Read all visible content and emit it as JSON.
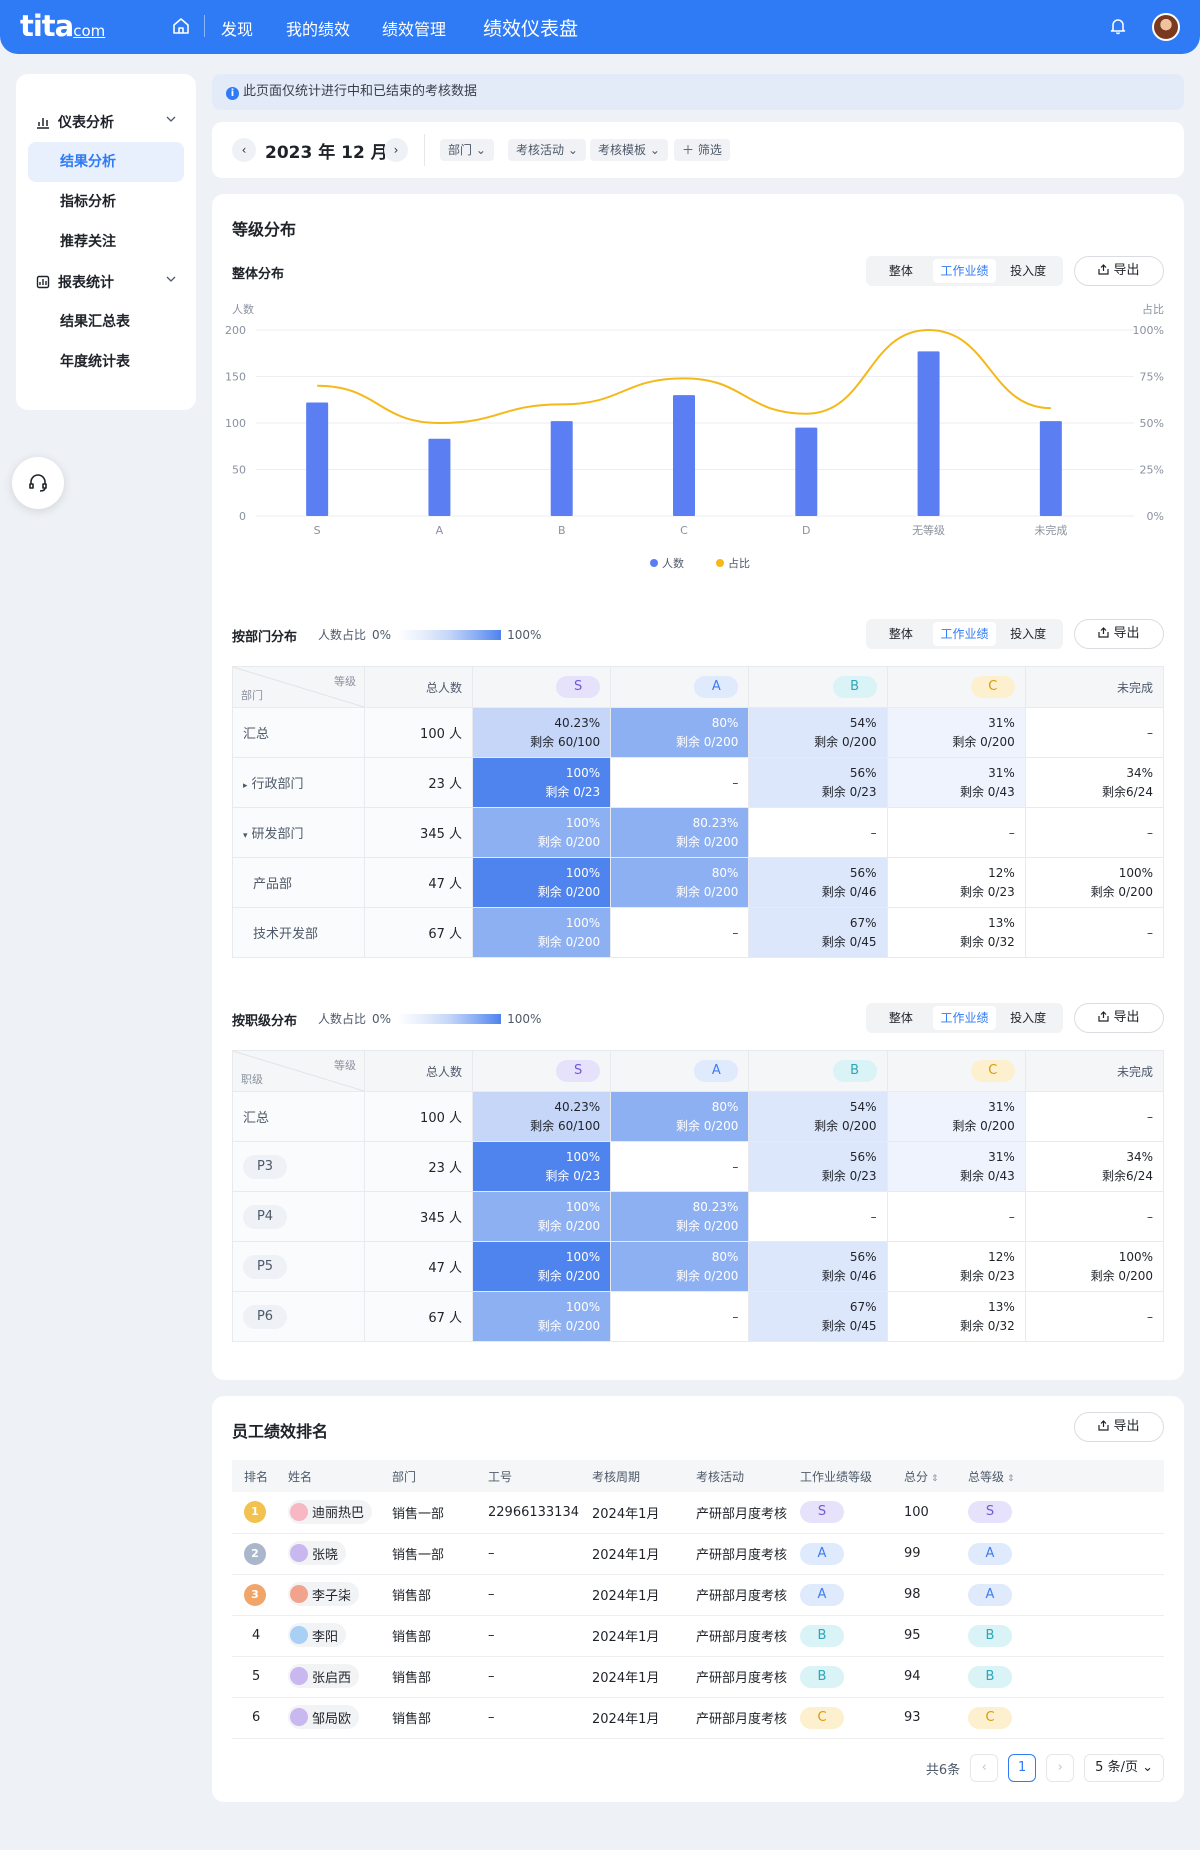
{
  "topbar": {
    "logo": "tita",
    "logo_suffix": "com",
    "nav": [
      "发现",
      "我的绩效",
      "绩效管理",
      "绩效仪表盘"
    ]
  },
  "sidebar": {
    "groups": [
      {
        "label": "仪表分析",
        "items": [
          "结果分析",
          "指标分析",
          "推荐关注"
        ]
      },
      {
        "label": "报表统计",
        "items": [
          "结果汇总表",
          "年度统计表"
        ]
      }
    ]
  },
  "notice": "此页面仅统计进行中和已结束的考核数据",
  "filter": {
    "date": "2023 年 12 月",
    "chips": [
      "部门",
      "考核活动",
      "考核模板",
      "＋ 筛选"
    ]
  },
  "grade_card": {
    "title": "等级分布",
    "overall_title": "整体分布",
    "tabs": [
      "整体",
      "工作业绩",
      "投入度"
    ],
    "export": "导出"
  },
  "chart_data": {
    "type": "bar",
    "categories": [
      "S",
      "A",
      "B",
      "C",
      "D",
      "无等级",
      "未完成"
    ],
    "series": [
      {
        "name": "人数",
        "type": "bar",
        "values": [
          122,
          83,
          102,
          130,
          95,
          177,
          102
        ],
        "color": "#5b7ff3"
      },
      {
        "name": "占比",
        "type": "line",
        "values": [
          70,
          50,
          60,
          74,
          55,
          100,
          58
        ],
        "color": "#f5b819"
      }
    ],
    "ylabel": "人数",
    "ylabel_right": "占比",
    "ylim": [
      0,
      200
    ],
    "yticks": [
      "0",
      "50",
      "100",
      "150",
      "200"
    ],
    "y2lim": [
      0,
      100
    ],
    "y2ticks": [
      "0%",
      "25%",
      "50%",
      "75%",
      "100%"
    ],
    "legend_position": "bottom",
    "grid": true
  },
  "dept_table": {
    "title": "按部门分布",
    "legend_label": "人数占比",
    "legend_min": "0%",
    "legend_max": "100%",
    "corner_top": "等级",
    "corner_bottom": "部门",
    "headers": [
      "总人数",
      "S",
      "A",
      "B",
      "C",
      "未完成"
    ],
    "rows": [
      {
        "name": "汇总",
        "prefix": "",
        "total": "100 人",
        "cells": [
          {
            "pct": "40.23%",
            "rem": "剩余 60/100",
            "level": 0.25
          },
          {
            "pct": "80%",
            "rem": "剩余 0/200",
            "level": 0.6
          },
          {
            "pct": "54%",
            "rem": "剩余 0/200",
            "level": 0.2
          },
          {
            "pct": "31%",
            "rem": "剩余 0/200",
            "level": 0.05
          },
          {
            "pct": "",
            "rem": "",
            "level": 0
          }
        ]
      },
      {
        "name": "行政部门",
        "prefix": "▸",
        "total": "23 人",
        "cells": [
          {
            "pct": "100%",
            "rem": "剩余 0/23",
            "level": 1
          },
          {
            "pct": "",
            "rem": "",
            "level": 0
          },
          {
            "pct": "56%",
            "rem": "剩余 0/23",
            "level": 0.2
          },
          {
            "pct": "31%",
            "rem": "剩余 0/43",
            "level": 0.05
          },
          {
            "pct": "34%",
            "rem": "剩余6/24",
            "level": 0
          }
        ]
      },
      {
        "name": "研发部门",
        "prefix": "▾",
        "total": "345 人",
        "cells": [
          {
            "pct": "100%",
            "rem": "剩余 0/200",
            "level": 0.6
          },
          {
            "pct": "80.23%",
            "rem": "剩余 0/200",
            "level": 0.6
          },
          {
            "pct": "",
            "rem": "",
            "level": 0
          },
          {
            "pct": "",
            "rem": "",
            "level": 0
          },
          {
            "pct": "",
            "rem": "",
            "level": 0
          }
        ]
      },
      {
        "name": "产品部",
        "prefix": "",
        "total": "47 人",
        "cells": [
          {
            "pct": "100%",
            "rem": "剩余 0/200",
            "level": 1
          },
          {
            "pct": "80%",
            "rem": "剩余 0/200",
            "level": 0.6
          },
          {
            "pct": "56%",
            "rem": "剩余 0/46",
            "level": 0.2
          },
          {
            "pct": "12%",
            "rem": "剩余 0/23",
            "level": 0
          },
          {
            "pct": "100%",
            "rem": "剩余 0/200",
            "level": 0
          }
        ]
      },
      {
        "name": "技术开发部",
        "prefix": "",
        "total": "67 人",
        "cells": [
          {
            "pct": "100%",
            "rem": "剩余 0/200",
            "level": 0.6
          },
          {
            "pct": "",
            "rem": "",
            "level": 0
          },
          {
            "pct": "67%",
            "rem": "剩余 0/45",
            "level": 0.2
          },
          {
            "pct": "13%",
            "rem": "剩余 0/32",
            "level": 0
          },
          {
            "pct": "",
            "rem": "",
            "level": 0
          }
        ]
      }
    ]
  },
  "level_table": {
    "title": "按职级分布",
    "legend_label": "人数占比",
    "legend_min": "0%",
    "legend_max": "100%",
    "corner_top": "等级",
    "corner_bottom": "职级",
    "headers": [
      "总人数",
      "S",
      "A",
      "B",
      "C",
      "未完成"
    ],
    "rows": [
      {
        "name": "汇总",
        "tag": false,
        "total": "100 人",
        "cells": [
          {
            "pct": "40.23%",
            "rem": "剩余 60/100",
            "level": 0.25
          },
          {
            "pct": "80%",
            "rem": "剩余 0/200",
            "level": 0.6
          },
          {
            "pct": "54%",
            "rem": "剩余 0/200",
            "level": 0.2
          },
          {
            "pct": "31%",
            "rem": "剩余 0/200",
            "level": 0.05
          },
          {
            "pct": "",
            "rem": "",
            "level": 0
          }
        ]
      },
      {
        "name": "P3",
        "tag": true,
        "total": "23 人",
        "cells": [
          {
            "pct": "100%",
            "rem": "剩余 0/23",
            "level": 1
          },
          {
            "pct": "",
            "rem": "",
            "level": 0
          },
          {
            "pct": "56%",
            "rem": "剩余 0/23",
            "level": 0.2
          },
          {
            "pct": "31%",
            "rem": "剩余 0/43",
            "level": 0.05
          },
          {
            "pct": "34%",
            "rem": "剩余6/24",
            "level": 0
          }
        ]
      },
      {
        "name": "P4",
        "tag": true,
        "total": "345 人",
        "cells": [
          {
            "pct": "100%",
            "rem": "剩余 0/200",
            "level": 0.6
          },
          {
            "pct": "80.23%",
            "rem": "剩余 0/200",
            "level": 0.6
          },
          {
            "pct": "",
            "rem": "",
            "level": 0
          },
          {
            "pct": "",
            "rem": "",
            "level": 0
          },
          {
            "pct": "",
            "rem": "",
            "level": 0
          }
        ]
      },
      {
        "name": "P5",
        "tag": true,
        "total": "47 人",
        "cells": [
          {
            "pct": "100%",
            "rem": "剩余 0/200",
            "level": 1
          },
          {
            "pct": "80%",
            "rem": "剩余 0/200",
            "level": 0.6
          },
          {
            "pct": "56%",
            "rem": "剩余 0/46",
            "level": 0.2
          },
          {
            "pct": "12%",
            "rem": "剩余 0/23",
            "level": 0
          },
          {
            "pct": "100%",
            "rem": "剩余 0/200",
            "level": 0
          }
        ]
      },
      {
        "name": "P6",
        "tag": true,
        "total": "67 人",
        "cells": [
          {
            "pct": "100%",
            "rem": "剩余 0/200",
            "level": 0.6
          },
          {
            "pct": "",
            "rem": "",
            "level": 0
          },
          {
            "pct": "67%",
            "rem": "剩余 0/45",
            "level": 0.2
          },
          {
            "pct": "13%",
            "rem": "剩余 0/32",
            "level": 0
          },
          {
            "pct": "",
            "rem": "",
            "level": 0
          }
        ]
      }
    ]
  },
  "ranking": {
    "title": "员工绩效排名",
    "export": "导出",
    "headers": [
      "排名",
      "姓名",
      "部门",
      "工号",
      "考核周期",
      "考核活动",
      "工作业绩等级",
      "总分",
      "总等级"
    ],
    "rows": [
      {
        "rank": "1",
        "medal": "gold",
        "name": "迪丽热巴",
        "dept": "销售一部",
        "id": "22966133134",
        "period": "2024年1月",
        "activity": "产研部月度考核",
        "grade": "S",
        "score": "100",
        "total_grade": "S"
      },
      {
        "rank": "2",
        "medal": "silver",
        "name": "张晓",
        "dept": "销售一部",
        "id": "–",
        "period": "2024年1月",
        "activity": "产研部月度考核",
        "grade": "A",
        "score": "99",
        "total_grade": "A"
      },
      {
        "rank": "3",
        "medal": "bronze",
        "name": "李子柒",
        "dept": "销售部",
        "id": "–",
        "period": "2024年1月",
        "activity": "产研部月度考核",
        "grade": "A",
        "score": "98",
        "total_grade": "A"
      },
      {
        "rank": "4",
        "medal": "",
        "name": "李阳",
        "dept": "销售部",
        "id": "–",
        "period": "2024年1月",
        "activity": "产研部月度考核",
        "grade": "B",
        "score": "95",
        "total_grade": "B"
      },
      {
        "rank": "5",
        "medal": "",
        "name": "张启西",
        "dept": "销售部",
        "id": "–",
        "period": "2024年1月",
        "activity": "产研部月度考核",
        "grade": "B",
        "score": "94",
        "total_grade": "B"
      },
      {
        "rank": "6",
        "medal": "",
        "name": "邹局欧",
        "dept": "销售部",
        "id": "–",
        "period": "2024年1月",
        "activity": "产研部月度考核",
        "grade": "C",
        "score": "93",
        "total_grade": "C"
      }
    ],
    "pager": {
      "total": "共6条",
      "page": "1",
      "size": "5 条/页"
    }
  },
  "grade_colors": {
    "S": {
      "bg": "#e7e2fb",
      "fg": "#7357d9"
    },
    "A": {
      "bg": "#dfeafd",
      "fg": "#3d7bf0"
    },
    "B": {
      "bg": "#d9f3f6",
      "fg": "#2ca6b8"
    },
    "C": {
      "bg": "#fdf0cf",
      "fg": "#d99a0c"
    }
  }
}
